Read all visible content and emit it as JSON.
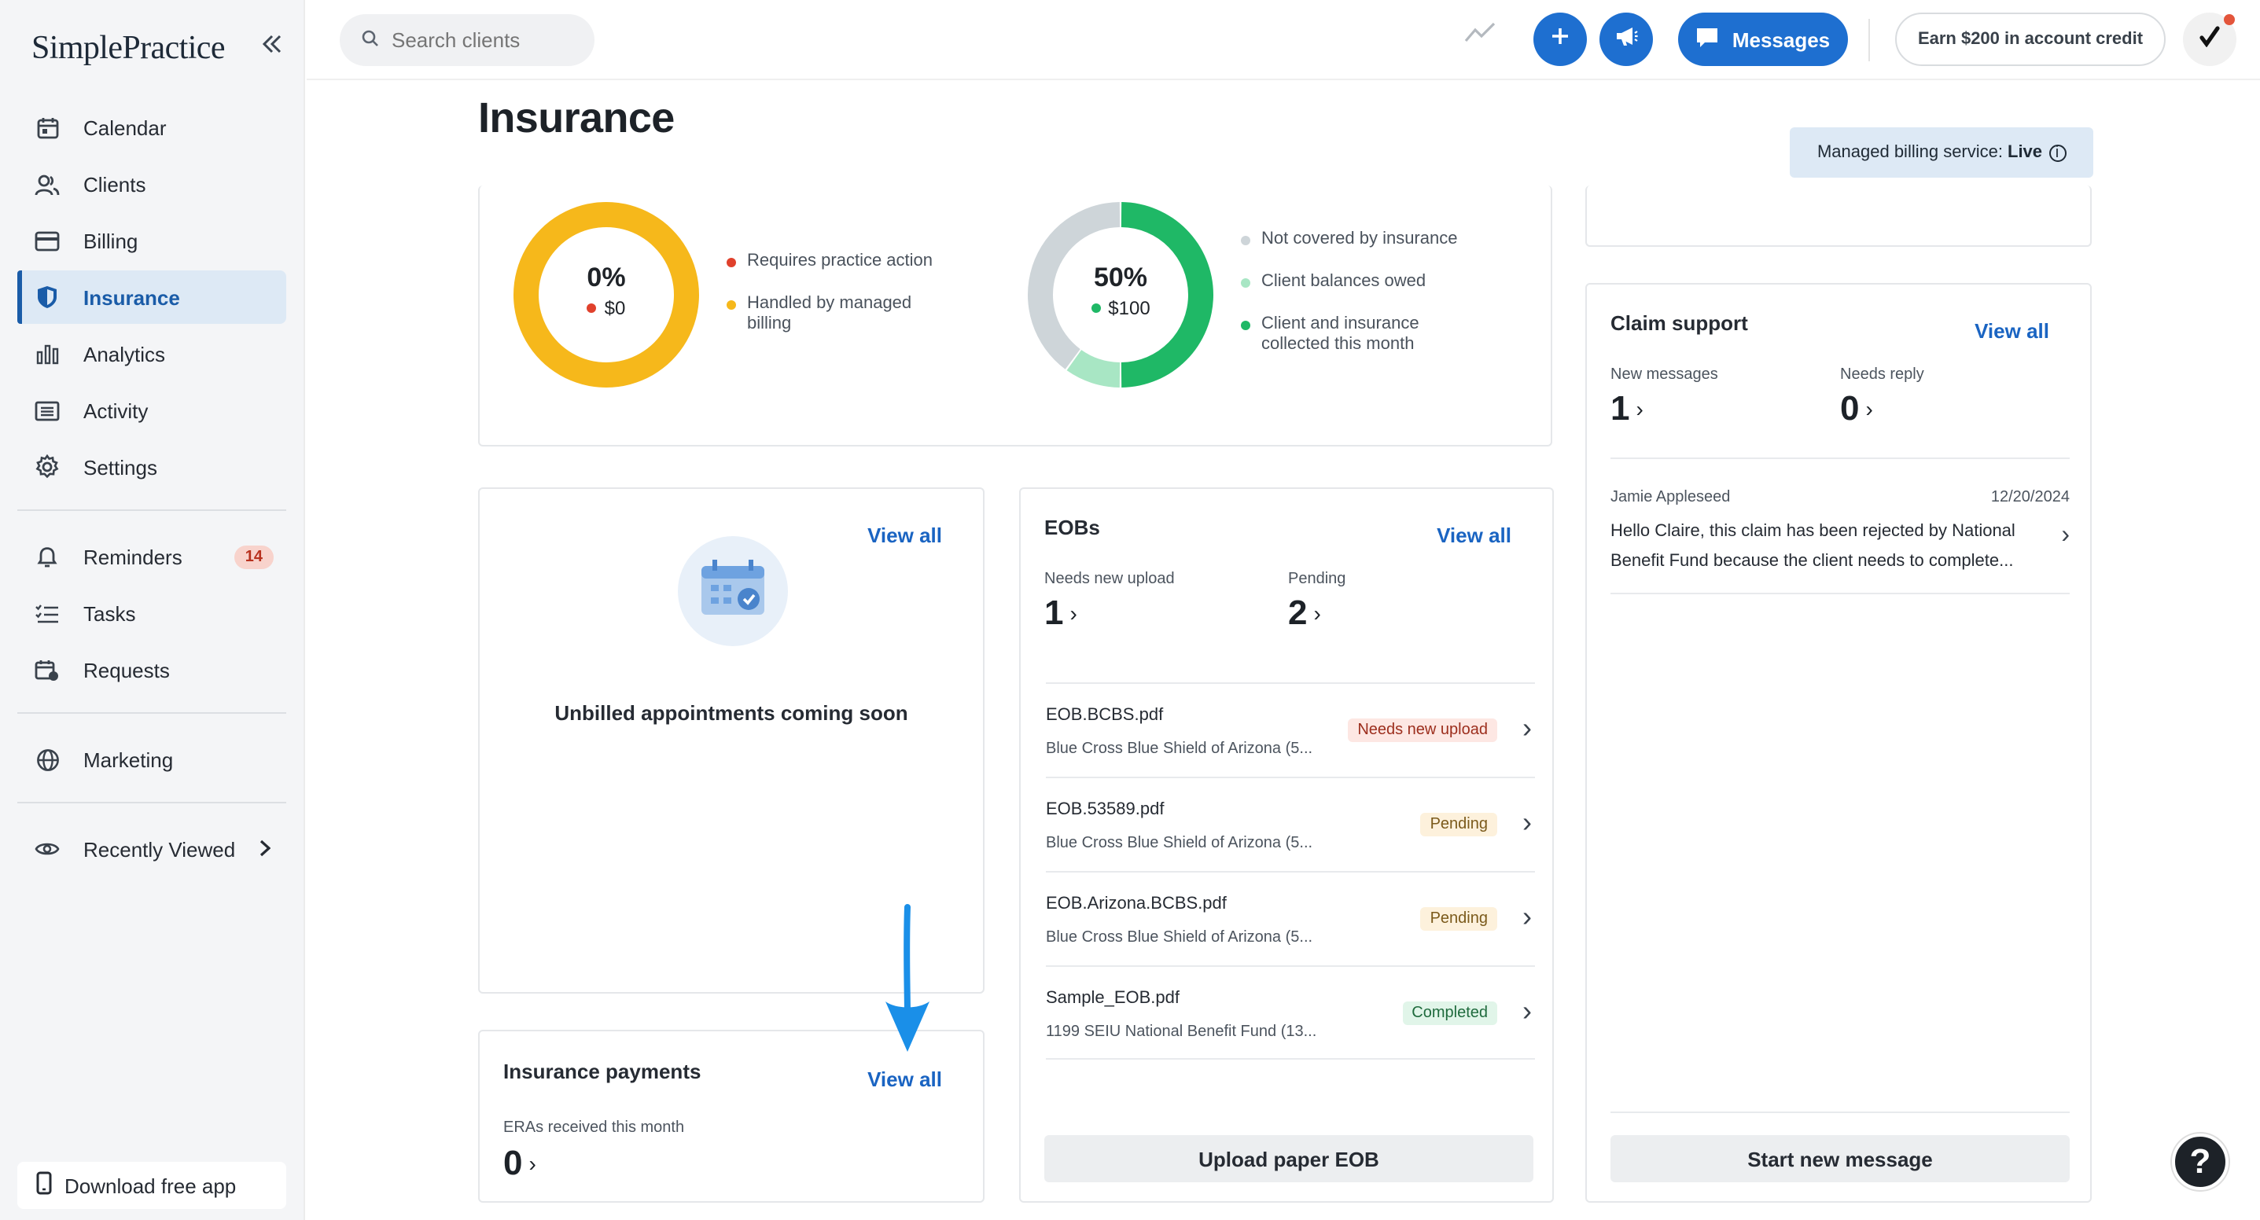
{
  "app": {
    "logo": "SimplePractice",
    "collapse_icon": "double-chevron-left-icon"
  },
  "sidebar": {
    "items": [
      {
        "label": "Calendar",
        "icon": "calendar-icon"
      },
      {
        "label": "Clients",
        "icon": "clients-icon"
      },
      {
        "label": "Billing",
        "icon": "billing-card-icon"
      },
      {
        "label": "Insurance",
        "icon": "shield-icon",
        "active": true
      },
      {
        "label": "Analytics",
        "icon": "bar-chart-icon"
      },
      {
        "label": "Activity",
        "icon": "activity-list-icon"
      },
      {
        "label": "Settings",
        "icon": "gear-icon"
      }
    ],
    "secondary": [
      {
        "label": "Reminders",
        "icon": "bell-icon",
        "badge": "14"
      },
      {
        "label": "Tasks",
        "icon": "tasks-icon"
      },
      {
        "label": "Requests",
        "icon": "requests-icon"
      }
    ],
    "marketing": {
      "label": "Marketing",
      "icon": "globe-icon"
    },
    "recently_viewed": {
      "label": "Recently Viewed",
      "icon": "eye-icon"
    },
    "download": {
      "label": "Download free app",
      "icon": "phone-icon"
    }
  },
  "topbar": {
    "search_placeholder": "Search clients",
    "messages_label": "Messages",
    "earn_label": "Earn $200 in account credit"
  },
  "page": {
    "title": "Insurance",
    "managed_billing": {
      "label": "Managed billing service:",
      "status": "Live"
    }
  },
  "donuts": [
    {
      "pct": "0%",
      "amount": "$0",
      "amount_dot_color": "#e0412c",
      "legend": [
        {
          "label": "Requires practice action",
          "color": "#e0412c"
        },
        {
          "label": "Handled by managed billing",
          "color": "#f6b81b"
        }
      ]
    },
    {
      "pct": "50%",
      "amount": "$100",
      "amount_dot_color": "#1fb866",
      "legend": [
        {
          "label": "Not covered by insurance",
          "color": "#ced5d9"
        },
        {
          "label": "Client balances owed",
          "color": "#a8e6c4"
        },
        {
          "label": "Client and insurance collected this month",
          "color": "#1fb866"
        }
      ]
    }
  ],
  "unbilled": {
    "view_all": "View all",
    "message": "Unbilled appointments coming soon"
  },
  "payments": {
    "title": "Insurance payments",
    "view_all": "View all",
    "label": "ERAs received this month",
    "count": "0"
  },
  "eobs": {
    "title": "EOBs",
    "view_all": "View all",
    "needs_upload_label": "Needs new upload",
    "needs_upload_count": "1",
    "pending_label": "Pending",
    "pending_count": "2",
    "rows": [
      {
        "name": "EOB.BCBS.pdf",
        "payer": "Blue Cross Blue Shield of Arizona (5...",
        "status": "Needs new upload",
        "tone": "red"
      },
      {
        "name": "EOB.53589.pdf",
        "payer": "Blue Cross Blue Shield of Arizona (5...",
        "status": "Pending",
        "tone": "yellow"
      },
      {
        "name": "EOB.Arizona.BCBS.pdf",
        "payer": "Blue Cross Blue Shield of Arizona (5...",
        "status": "Pending",
        "tone": "yellow"
      },
      {
        "name": "Sample_EOB.pdf",
        "payer": "1199 SEIU National Benefit Fund (13...",
        "status": "Completed",
        "tone": "green"
      }
    ],
    "upload_button": "Upload paper EOB"
  },
  "claim_support": {
    "title": "Claim support",
    "view_all": "View all",
    "new_messages_label": "New messages",
    "new_messages_count": "1",
    "needs_reply_label": "Needs reply",
    "needs_reply_count": "0",
    "message": {
      "sender": "Jamie Appleseed",
      "date": "12/20/2024",
      "preview": "Hello Claire, this claim has been rejected by National Benefit Fund because the client needs to complete..."
    },
    "start_button": "Start new message"
  },
  "colors": {
    "accent": "#1e6fd0",
    "annotation_arrow": "#1a8fe8",
    "donut_yellow": "#f6b81b",
    "donut_green": "#1fb866",
    "donut_light_green": "#a8e6c4",
    "donut_gray": "#ced5d9"
  },
  "donut_shares": [
    {
      "segments": [
        {
          "label": "Handled by managed billing",
          "fraction": 1.0
        }
      ]
    },
    {
      "segments": [
        {
          "label": "Client and insurance collected this month",
          "fraction": 0.5
        },
        {
          "label": "Client balances owed",
          "fraction": 0.1
        },
        {
          "label": "Not covered by insurance",
          "fraction": 0.4
        }
      ]
    }
  ]
}
